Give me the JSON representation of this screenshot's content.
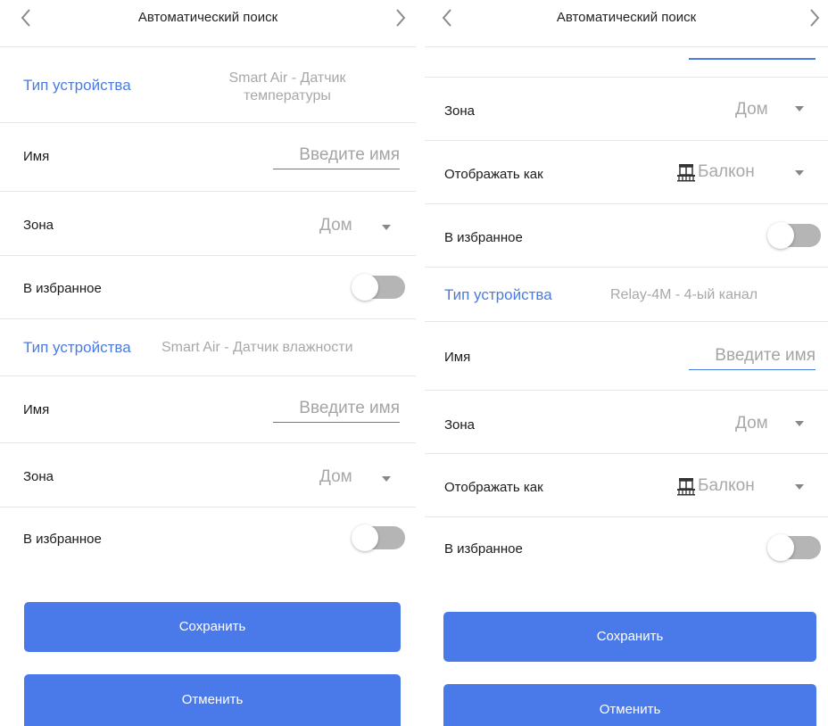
{
  "colors": {
    "accent": "#4a7ae9",
    "label_blue": "#4a7be0",
    "toggle_off": "#b5b5b5"
  },
  "left": {
    "header": {
      "title": "Автоматический поиск",
      "back_icon": "chevron-left-icon",
      "forward_icon": "chevron-right-icon"
    },
    "device1": {
      "type_label": "Тип устройства",
      "type_value_line1": "Smart Air - Датчик",
      "type_value_line2": "температуры",
      "name_label": "Имя",
      "name_placeholder": "Введите имя",
      "zone_label": "Зона",
      "zone_value": "Дом",
      "favorite_label": "В избранное",
      "favorite_on": false
    },
    "device2": {
      "type_label": "Тип устройства",
      "type_value": "Smart Air - Датчик влажности",
      "name_label": "Имя",
      "name_placeholder": "Введите имя",
      "zone_label": "Зона",
      "zone_value": "Дом",
      "favorite_label": "В избранное",
      "favorite_on": false
    },
    "save_label": "Сохранить",
    "cancel_label": "Отменить"
  },
  "right": {
    "header": {
      "title": "Автоматический поиск",
      "back_icon": "chevron-left-icon",
      "forward_icon": "chevron-right-icon"
    },
    "device1": {
      "zone_label": "Зона",
      "zone_value": "Дом",
      "display_label": "Отображать как",
      "display_value": "Балкон",
      "display_icon": "balcony-icon",
      "favorite_label": "В избранное",
      "favorite_on": false
    },
    "device2": {
      "type_label": "Тип устройства",
      "type_value": "Relay-4M - 4-ый канал",
      "name_label": "Имя",
      "name_placeholder": "Введите имя",
      "zone_label": "Зона",
      "zone_value": "Дом",
      "display_label": "Отображать как",
      "display_value": "Балкон",
      "display_icon": "balcony-icon",
      "favorite_label": "В избранное",
      "favorite_on": false
    },
    "save_label": "Сохранить",
    "cancel_label": "Отменить"
  }
}
